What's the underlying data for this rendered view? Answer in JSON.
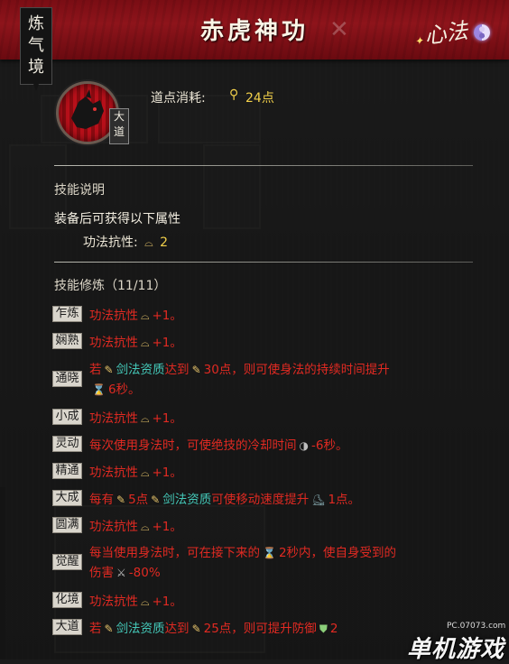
{
  "window": {
    "title": "赤虎神功",
    "realm_label": [
      "炼",
      "气",
      "境"
    ],
    "xinfa_logo": "心法",
    "close_icon": "close-icon"
  },
  "skill": {
    "grade": [
      "大",
      "道"
    ],
    "cost_label": "道点消耗:",
    "cost_value": "24点",
    "cost_icon": "dao-point-icon"
  },
  "description": {
    "section_title": "技能说明",
    "equip_text": "装备后可获得以下属性",
    "attribute_label": "功法抗性:",
    "attribute_value": "2"
  },
  "cultivation": {
    "section_title": "技能修炼（11/11）",
    "levels": [
      {
        "tag": "乍炼",
        "text": "功法抗性",
        "value": "+1。"
      },
      {
        "tag": "娴熟",
        "text": "功法抗性",
        "value": "+1。"
      },
      {
        "tag": "通晓",
        "line1": {
          "a": "若",
          "b": "剑法资质",
          "c": "达到",
          "d": "30点，则可使身法的持续时间提升"
        },
        "line2": "6秒。"
      },
      {
        "tag": "小成",
        "text": "功法抗性",
        "value": "+1。"
      },
      {
        "tag": "灵动",
        "text": "每次使用身法时，可使绝技的冷却时间",
        "value": "-6秒。"
      },
      {
        "tag": "精通",
        "text": "功法抗性",
        "value": "+1。"
      },
      {
        "tag": "大成",
        "a": "每有",
        "b": "5点",
        "c": "剑法资质",
        "d": "可使移动速度提升",
        "e": "1点。"
      },
      {
        "tag": "圆满",
        "text": "功法抗性",
        "value": "+1。"
      },
      {
        "tag": "觉醒",
        "line1": {
          "a": "每当使用身法时，可在接下来的",
          "b": "2秒内，使自身受到的"
        },
        "line2": {
          "a": "伤害",
          "b": "-80%"
        }
      },
      {
        "tag": "化境",
        "text": "功法抗性",
        "value": "+1。"
      },
      {
        "tag": "大道",
        "a": "若",
        "b": "剑法资质",
        "c": "达到",
        "d": "25点，则可提升防御",
        "e": "2"
      }
    ]
  },
  "watermark": {
    "site": "PC.07073.com",
    "brand": "单机游戏"
  }
}
